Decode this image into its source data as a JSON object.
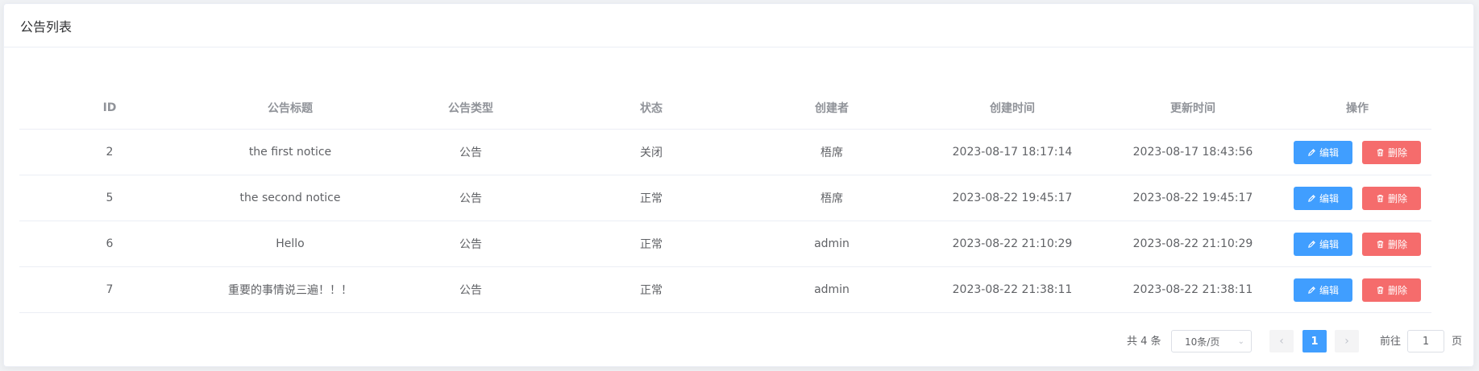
{
  "card": {
    "title": "公告列表"
  },
  "table": {
    "columns": [
      "ID",
      "公告标题",
      "公告类型",
      "状态",
      "创建者",
      "创建时间",
      "更新时间",
      "操作"
    ],
    "rows": [
      {
        "id": "2",
        "title": "the first notice",
        "type": "公告",
        "status": "关闭",
        "creator": "梧席",
        "created": "2023-08-17 18:17:14",
        "updated": "2023-08-17 18:43:56"
      },
      {
        "id": "5",
        "title": "the second notice",
        "type": "公告",
        "status": "正常",
        "creator": "梧席",
        "created": "2023-08-22 19:45:17",
        "updated": "2023-08-22 19:45:17"
      },
      {
        "id": "6",
        "title": "Hello",
        "type": "公告",
        "status": "正常",
        "creator": "admin",
        "created": "2023-08-22 21:10:29",
        "updated": "2023-08-22 21:10:29"
      },
      {
        "id": "7",
        "title": "重要的事情说三遍！！！",
        "type": "公告",
        "status": "正常",
        "creator": "admin",
        "created": "2023-08-22 21:38:11",
        "updated": "2023-08-22 21:38:11"
      }
    ],
    "actions": {
      "edit_label": "编辑",
      "delete_label": "删除",
      "edit_icon": "pencil-icon",
      "delete_icon": "trash-icon"
    }
  },
  "pagination": {
    "total_text": "共 4 条",
    "page_size": "10条/页",
    "current_page": "1",
    "goto_label": "前往",
    "goto_value": "1",
    "goto_suffix": "页"
  },
  "colors": {
    "primary": "#409eff",
    "danger": "#f56c6c",
    "border": "#ebeef5"
  }
}
